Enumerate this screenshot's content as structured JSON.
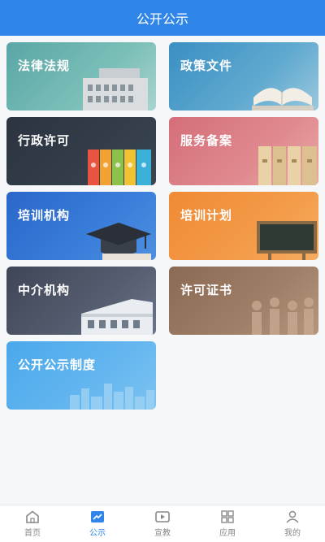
{
  "header": {
    "title": "公开公示"
  },
  "cards": [
    {
      "label": "法律法规"
    },
    {
      "label": "政策文件"
    },
    {
      "label": "行政许可"
    },
    {
      "label": "服务备案"
    },
    {
      "label": "培训机构"
    },
    {
      "label": "培训计划"
    },
    {
      "label": "中介机构"
    },
    {
      "label": "许可证书"
    },
    {
      "label": "公开公示制度"
    }
  ],
  "tabs": [
    {
      "label": "首页",
      "icon": "home-icon",
      "active": false
    },
    {
      "label": "公示",
      "icon": "chart-icon",
      "active": true
    },
    {
      "label": "宣教",
      "icon": "video-icon",
      "active": false
    },
    {
      "label": "应用",
      "icon": "apps-icon",
      "active": false
    },
    {
      "label": "我的",
      "icon": "user-icon",
      "active": false
    }
  ],
  "colors": {
    "primary": "#2f86e8",
    "tab_inactive": "#888888"
  }
}
